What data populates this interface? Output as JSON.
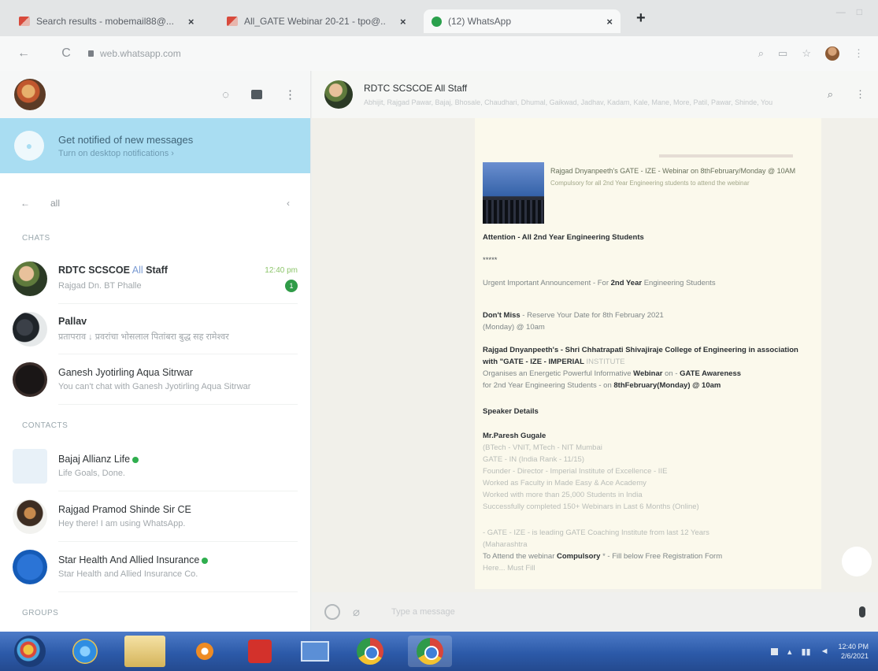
{
  "browser": {
    "tabs": [
      {
        "title": "Search results - mobemail88@...",
        "icon": "gmail-icon"
      },
      {
        "title": "All_GATE Webinar 20-21 - tpo@...",
        "icon": "gmail-icon"
      },
      {
        "title": "(12) WhatsApp",
        "icon": "whatsapp-icon",
        "active": true
      }
    ],
    "close_glyph": "×",
    "new_tab_glyph": "+",
    "address": "web.whatsapp.com",
    "nav": {
      "back": "←",
      "reload": "C"
    }
  },
  "sidebar": {
    "notification": {
      "title": "Get notified of new messages",
      "subtitle": "Turn on desktop notifications ›"
    },
    "search": {
      "back_glyph": "←",
      "query": "all",
      "clear_glyph": "‹"
    },
    "sections": {
      "chats": "CHATS",
      "contacts": "CONTACTS",
      "groups": "GROUPS"
    },
    "chats": [
      {
        "name_bold": "RDTC SCSCOE",
        "name_hl": "All",
        "name_rest": "Staff",
        "time": "12:40 pm",
        "preview": "Rajgad Dn. BT Phalle",
        "unread": "1"
      },
      {
        "name_bold": "Pallav",
        "name_hl": "",
        "name_rest": "",
        "time": "",
        "preview": "प्रतापराव ↓ प्रवरांचा भोसलाल पितांबरा बुद्ध सह रामेश्वर",
        "unread": ""
      },
      {
        "name_bold": "",
        "name_hl": "",
        "name_rest": "Ganesh Jyotirling Aqua Sitrwar",
        "time": "",
        "preview": "You can't chat with Ganesh Jyotirling Aqua Sitrwar",
        "unread": ""
      }
    ],
    "contacts": [
      {
        "name": "Bajaj Allianz Life",
        "verified": true,
        "status": "Life Goals, Done."
      },
      {
        "name": "Rajgad Pramod Shinde Sir CE",
        "verified": false,
        "status": "Hey there! I am using WhatsApp."
      },
      {
        "name": "Star Health And Allied Insurance",
        "verified": true,
        "status": "Star Health and Allied Insurance Co."
      }
    ]
  },
  "conversation": {
    "title": "RDTC SCSCOE All Staff",
    "members": "Abhijit, Rajgad Pawar, Bajaj, Bhosale, Chaudhari, Dhumal, Gaikwad, Jadhav, Kadam, Kale, Mane, More, Patil, Pawar, Shinde, You",
    "link_card": {
      "title": "Rajgad Dnyanpeeth's GATE - IZE - Webinar on 8thFebruary/Monday @ 10AM",
      "desc": "Compulsory for all 2nd Year Engineering students to attend the webinar"
    },
    "message": {
      "attention": "Attention - All 2nd Year Engineering Students",
      "stars": "*****",
      "announce_pre": "Urgent Important Announcement - For",
      "announce_bold": "2nd Year",
      "announce_post": "Engineering Students",
      "dont_miss_bold": "Don't Miss",
      "dont_miss_rest": "- Reserve Your Date for 8th February 2021",
      "dont_miss_line2": "(Monday) @ 10am",
      "org_bold": "Rajgad Dnyanpeeth's - Shri Chhatrapati Shivajiraje College of Engineering in association with \"GATE - IZE - IMPERIAL",
      "org_dim": "INSTITUTE",
      "org_line2_pre": "Organises an Energetic Powerful Informative",
      "org_line2_bold": "Webinar",
      "org_line2_mid": "on -",
      "org_line2_bold2": "GATE Awareness",
      "org_line3_pre": "for 2nd Year Engineering Students - on",
      "org_line3_bold": "8thFebruary(Monday) @ 10am",
      "speaker_heading": "Speaker Details",
      "speaker_name": "Mr.Paresh Gugale",
      "speaker_lines": [
        "(BTech - VNIT, MTech - NIT Mumbai",
        "GATE - IN (India Rank - 11/15)",
        "Founder - Director - Imperial Institute of Excellence - IIE",
        "Worked as Faculty in Made Easy & Ace Academy",
        "Worked with more than 25,000 Students in India",
        "Successfully completed 150+ Webinars in Last 6 Months (Online)"
      ],
      "footer_line1": "- GATE - IZE - is leading GATE Coaching Institute from last 12 Years",
      "footer_line2": "(Maharashtra",
      "footer_line3_pre": "To Attend the webinar",
      "footer_line3_bold": "Compulsory",
      "footer_line3_post": "* - Fill below Free Registration Form",
      "footer_line4": "Here... Must Fill"
    },
    "composer_placeholder": "Type a message"
  },
  "taskbar": {
    "items": [
      "start-orb",
      "internet-explorer",
      "file-explorer",
      "media-player",
      "adobe-reader",
      "monitor-app",
      "chrome",
      "chrome-active"
    ],
    "clock_time": "12:40 PM",
    "clock_date": "2/6/2021"
  },
  "colors": {
    "notify_bg": "#a9ddf2",
    "unread_green": "#2f9b47",
    "bubble_bg": "#fbf9ec",
    "taskbar_blue": "#2c5aa9"
  }
}
